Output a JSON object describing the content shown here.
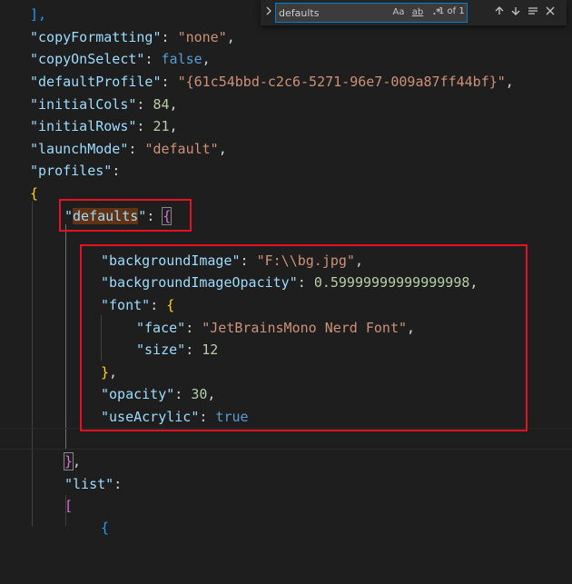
{
  "find_widget": {
    "query": "defaults",
    "match_case_label": "Aa",
    "whole_word_label": "ab",
    "regex_label": ".*",
    "result_count": "1 of 1",
    "toggle_replace_icon": "chevron-right-icon",
    "prev_icon": "arrow-up-icon",
    "next_icon": "arrow-down-icon",
    "selection_icon": "find-in-selection-icon",
    "close_icon": "close-icon"
  },
  "code": {
    "l1": "],",
    "copyFormatting_key": "\"copyFormatting\"",
    "copyFormatting_val": "\"none\"",
    "copyOnSelect_key": "\"copyOnSelect\"",
    "copyOnSelect_val": "false",
    "defaultProfile_key": "\"defaultProfile\"",
    "defaultProfile_val": "\"{61c54bbd-c2c6-5271-96e7-009a87ff44bf}\"",
    "initialCols_key": "\"initialCols\"",
    "initialCols_val": "84",
    "initialRows_key": "\"initialRows\"",
    "initialRows_val": "21",
    "launchMode_key": "\"launchMode\"",
    "launchMode_val": "\"default\"",
    "profiles_key": "\"profiles\"",
    "open_brace": "{",
    "defaults_quote_open": "\"",
    "defaults_word": "defaults",
    "defaults_quote_close": "\"",
    "defaults_open": "{",
    "backgroundImage_key": "\"backgroundImage\"",
    "backgroundImage_val": "\"F:\\\\bg.jpg\"",
    "backgroundImageOpacity_key": "\"backgroundImageOpacity\"",
    "backgroundImageOpacity_val": "0.59999999999999998",
    "font_key": "\"font\"",
    "font_open": "{",
    "face_key": "\"face\"",
    "face_val": "\"JetBrainsMono Nerd Font\"",
    "size_key": "\"size\"",
    "size_val": "12",
    "font_close": "}",
    "opacity_key": "\"opacity\"",
    "opacity_val": "30",
    "useAcrylic_key": "\"useAcrylic\"",
    "useAcrylic_val": "true",
    "defaults_close": "}",
    "list_key": "\"list\"",
    "list_open": "[",
    "next_brace": "{"
  },
  "colors": {
    "key": "#9cdcfe",
    "string": "#ce9178",
    "number": "#b5cea8",
    "boolean": "#569cd6",
    "highlight_box": "#e81123"
  }
}
